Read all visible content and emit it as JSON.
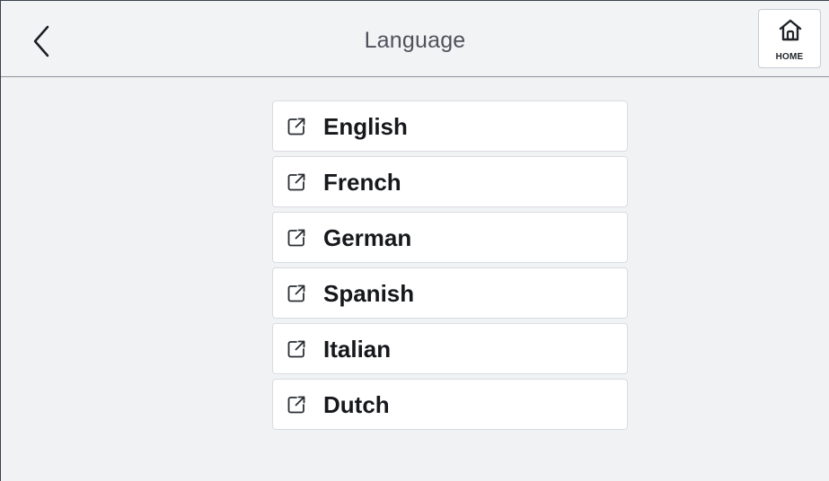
{
  "header": {
    "title": "Language",
    "back_icon": "chevron-left-icon",
    "home_label": "HOME",
    "home_icon": "home-icon"
  },
  "languages": [
    {
      "label": "English",
      "icon": "external-link-icon"
    },
    {
      "label": "French",
      "icon": "external-link-icon"
    },
    {
      "label": "German",
      "icon": "external-link-icon"
    },
    {
      "label": "Spanish",
      "icon": "external-link-icon"
    },
    {
      "label": "Italian",
      "icon": "external-link-icon"
    },
    {
      "label": "Dutch",
      "icon": "external-link-icon"
    }
  ],
  "colors": {
    "background": "#f1f2f4",
    "card": "#ffffff",
    "title_text": "#4e525b",
    "item_text": "#16181c"
  }
}
